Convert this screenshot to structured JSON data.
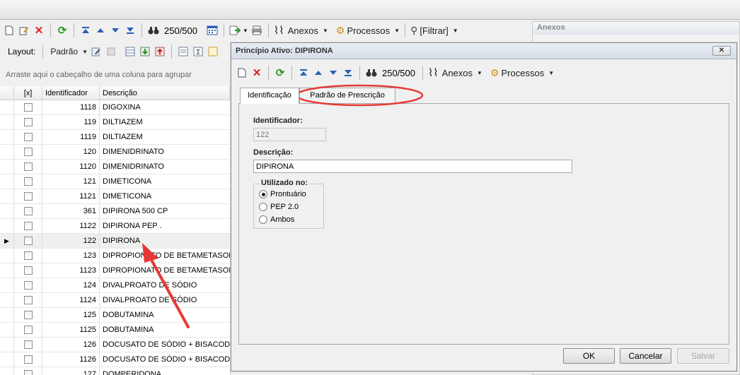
{
  "main_toolbar": {
    "count": "250/500",
    "anexos": "Anexos",
    "processos": "Processos",
    "filtrar": "[Filtrar]"
  },
  "layout_bar": {
    "layout_label": "Layout:",
    "padrao": "Padrão"
  },
  "group_hint": "Arraste aqui o cabeçalho de uma coluna para agrupar",
  "grid": {
    "columns": [
      "[x]",
      "Identificador",
      "Descrição"
    ],
    "rows": [
      {
        "id": "1118",
        "desc": "DIGOXINA"
      },
      {
        "id": "119",
        "desc": "DILTIAZEM"
      },
      {
        "id": "1119",
        "desc": "DILTIAZEM"
      },
      {
        "id": "120",
        "desc": "DIMENIDRINATO"
      },
      {
        "id": "1120",
        "desc": "DIMENIDRINATO"
      },
      {
        "id": "121",
        "desc": "DIMETICONA"
      },
      {
        "id": "1121",
        "desc": "DIMETICONA"
      },
      {
        "id": "361",
        "desc": "DIPIRONA 500 CP"
      },
      {
        "id": "1122",
        "desc": "DIPIRONA PEP ."
      },
      {
        "id": "122",
        "desc": "DIPIRONA"
      },
      {
        "id": "123",
        "desc": "DIPROPIONATO DE BETAMETASONA"
      },
      {
        "id": "1123",
        "desc": "DIPROPIONATO DE BETAMETASONA"
      },
      {
        "id": "124",
        "desc": "DIVALPROATO DE SÓDIO"
      },
      {
        "id": "1124",
        "desc": "DIVALPROATO DE SÓDIO"
      },
      {
        "id": "125",
        "desc": "DOBUTAMINA"
      },
      {
        "id": "1125",
        "desc": "DOBUTAMINA"
      },
      {
        "id": "126",
        "desc": "DOCUSATO DE SÓDIO  + BISACODIL"
      },
      {
        "id": "1126",
        "desc": "DOCUSATO DE SÓDIO  + BISACODIL"
      },
      {
        "id": "127",
        "desc": "DOMPERIDONA"
      }
    ]
  },
  "right_panel": {
    "title": "Anexos"
  },
  "dialog": {
    "title": "Princípio Ativo: DIPIRONA",
    "close": "✕",
    "count": "250/500",
    "anexos": "Anexos",
    "processos": "Processos",
    "tabs": [
      "Identificação",
      "Padrão de Prescrição"
    ],
    "identificador_label": "Identificador:",
    "identificador_value": "122",
    "descricao_label": "Descrição:",
    "descricao_value": "DIPIRONA",
    "utilizado_label": "Utilizado no:",
    "options": [
      "Prontuário",
      "PEP 2.0",
      "Ambos"
    ],
    "ok": "OK",
    "cancelar": "Cancelar",
    "salvar": "Salvar"
  },
  "colors": {
    "annotation_red": "#e53935",
    "selected_row": "#efefef",
    "dialog_title_bg": "#d6dce6"
  }
}
